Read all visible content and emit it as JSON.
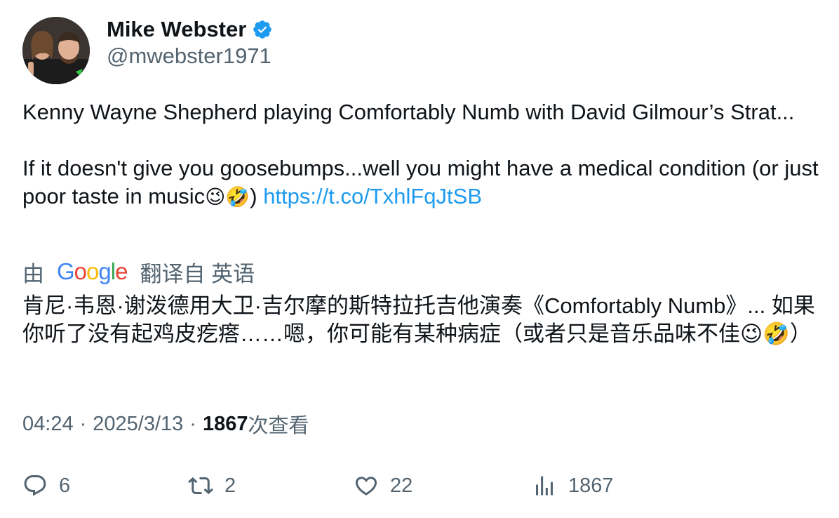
{
  "author": {
    "name": "Mike Webster",
    "handle": "@mwebster1971",
    "verified_icon": "verified-badge-icon",
    "accent_color": "#1d9bf0"
  },
  "tweet": {
    "text_line1": "Kenny Wayne Shepherd playing Comfortably Numb with David Gilmour’s Strat...",
    "text_line2": "If it doesn't give you goosebumps...well you might have a medical condition (or just poor taste in music",
    "emojis": "😉🤣",
    "close_paren": ")",
    "link": "https://t.co/TxhlFqJtSB"
  },
  "translation": {
    "prefix": "由",
    "provider": "Google",
    "suffix": "翻译自 英语",
    "text": "肯尼·韦恩·谢泼德用大卫·吉尔摩的斯特拉托吉他演奏《Comfortably Numb》... 如果你听了没有起鸡皮疙瘩……嗯，你可能有某种病症（或者只是音乐品味不佳😉🤣）"
  },
  "meta": {
    "time": "04:24",
    "separator": "·",
    "date": "2025/3/13",
    "views_count": "1867",
    "views_label": "次查看"
  },
  "actions": {
    "replies": "6",
    "retweets": "2",
    "likes": "22",
    "views": "1867"
  }
}
